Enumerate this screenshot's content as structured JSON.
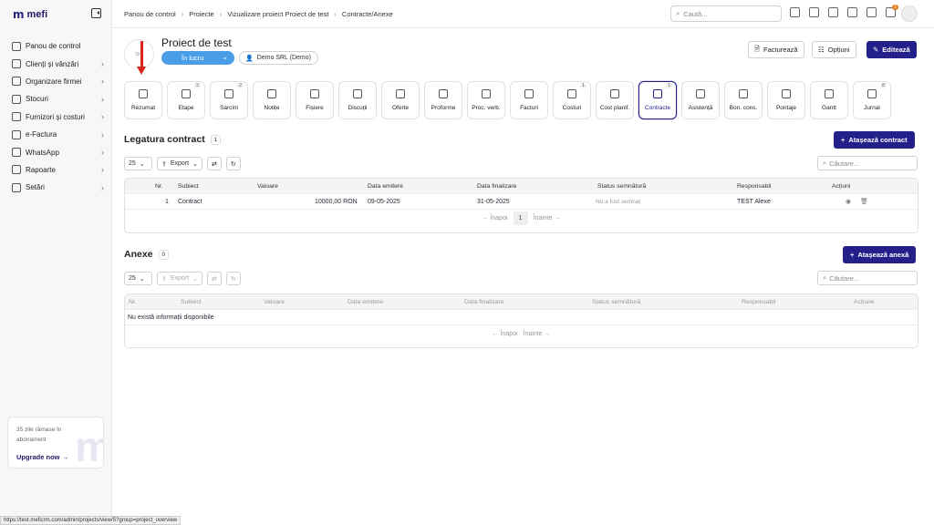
{
  "app": {
    "logo_text": "mefi"
  },
  "sidebar": {
    "items": [
      {
        "label": "Panou de control",
        "icon": "home-icon",
        "chevron": false
      },
      {
        "label": "Clienți și vânzări",
        "icon": "users-icon",
        "chevron": true
      },
      {
        "label": "Organizare firmei",
        "icon": "org-icon",
        "chevron": true
      },
      {
        "label": "Stocuri",
        "icon": "box-icon",
        "chevron": true
      },
      {
        "label": "Furnizori și costuri",
        "icon": "truck-icon",
        "chevron": true
      },
      {
        "label": "e-Factura",
        "icon": "efactura-icon",
        "chevron": true
      },
      {
        "label": "WhatsApp",
        "icon": "whatsapp-icon",
        "chevron": true
      },
      {
        "label": "Rapoarte",
        "icon": "reports-icon",
        "chevron": true
      },
      {
        "label": "Setări",
        "icon": "gear-icon",
        "chevron": true
      }
    ],
    "upgrade": {
      "text": "35 zile rămase în abonament",
      "link": "Upgrade now"
    }
  },
  "topbar": {
    "breadcrumbs": [
      "Panou de control",
      "Proiecte",
      "Vizualizare proiect Proiect de test",
      "Contracte/Anexe"
    ],
    "search_placeholder": "Caută...",
    "notification_count": "1"
  },
  "project": {
    "logo_text": "Dro",
    "title": "Proiect de test",
    "status": "În lucru",
    "client": "Demo SRL (Demo)",
    "buttons": {
      "invoice": "Facturează",
      "options": "Opțiuni",
      "edit": "Editează"
    }
  },
  "tabs": [
    {
      "label": "Rezumat",
      "count": ""
    },
    {
      "label": "Etape",
      "count": "2"
    },
    {
      "label": "Sarcini",
      "count": "2"
    },
    {
      "label": "Notițe",
      "count": ""
    },
    {
      "label": "Fișiere",
      "count": ""
    },
    {
      "label": "Discuții",
      "count": ""
    },
    {
      "label": "Oferte",
      "count": ""
    },
    {
      "label": "Proforme",
      "count": ""
    },
    {
      "label": "Proc. verb.",
      "count": ""
    },
    {
      "label": "Facturi",
      "count": ""
    },
    {
      "label": "Costuri",
      "count": "1"
    },
    {
      "label": "Cost planif.",
      "count": ""
    },
    {
      "label": "Contracte",
      "count": "1",
      "active": true
    },
    {
      "label": "Asistență",
      "count": ""
    },
    {
      "label": "Bon. cons.",
      "count": ""
    },
    {
      "label": "Pontaje",
      "count": ""
    },
    {
      "label": "Gantt",
      "count": ""
    },
    {
      "label": "Jurnal",
      "count": "8"
    }
  ],
  "contracts": {
    "title": "Legatura contract",
    "count": "1",
    "add_button": "Atașează contract",
    "page_size": "25",
    "export_label": "Export",
    "search_placeholder": "Căutare...",
    "columns": [
      "Nr.",
      "Subiect",
      "Valoare",
      "Data emitere",
      "Data finalizare",
      "Status semnătură",
      "Responsabil",
      "Acțiuni"
    ],
    "rows": [
      {
        "nr": "1",
        "subiect": "Contract",
        "valoare": "10000,00 RON",
        "emitere": "09-05-2025",
        "finalizare": "31-05-2025",
        "status": "Nu a fost semnat",
        "responsabil": "TEST Alexe"
      }
    ],
    "pager": {
      "prev": "← Înapoi",
      "page": "1",
      "next": "Înainte →"
    }
  },
  "annexes": {
    "title": "Anexe",
    "count": "0",
    "add_button": "Atașează anexă",
    "page_size": "25",
    "export_label": "Export",
    "search_placeholder": "Căutare...",
    "columns": [
      "Nr.",
      "Subiect",
      "Valoare",
      "Data emitere",
      "Data finalizare",
      "Status semnătură",
      "Responsabil",
      "Acțiune"
    ],
    "empty_text": "Nu există informații disponibile",
    "pager": {
      "prev": "← Înapoi",
      "next": "Înainte →"
    }
  },
  "status_bar_url": "https://test.meficrm.com/admin/projects/view/5?group=project_overview",
  "colors": {
    "primary": "#23208a",
    "status_blue": "#4a9ee8",
    "annotation_red": "#d9261c"
  }
}
